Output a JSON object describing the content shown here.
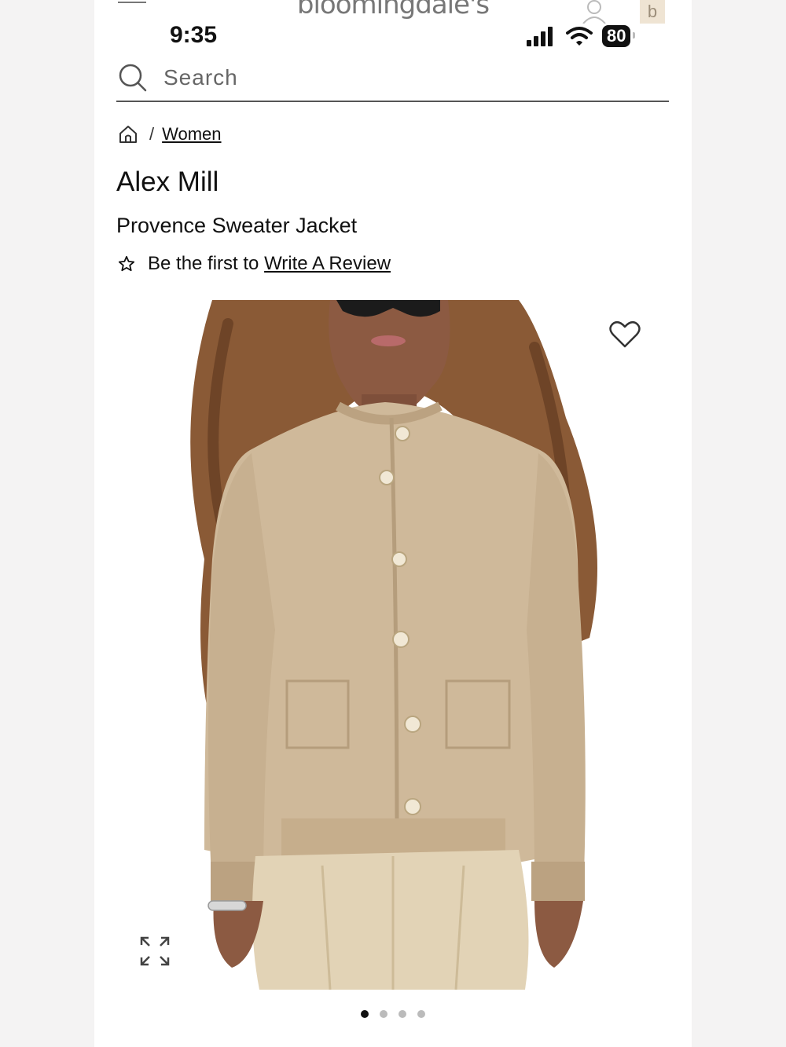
{
  "header": {
    "brand_logo": "bloomingdale's",
    "bag_letter": "b"
  },
  "status_bar": {
    "time": "9:35",
    "battery": "80"
  },
  "search": {
    "placeholder": "Search"
  },
  "breadcrumb": {
    "separator": "/",
    "items": [
      {
        "label": "Women"
      }
    ]
  },
  "product": {
    "brand": "Alex Mill",
    "name": "Provence Sweater Jacket",
    "review_prefix": "Be the first to",
    "review_link": "Write A Review"
  },
  "gallery": {
    "image_alt": "Model wearing a beige knit button-front sweater jacket",
    "current_index": 1,
    "total": 4
  },
  "colors": {
    "sweater": "#cfb99a",
    "sweater_shade": "#bba281",
    "pants": "#e2d3b6",
    "hair": "#8a5a36",
    "skin": "#8c5a42"
  }
}
